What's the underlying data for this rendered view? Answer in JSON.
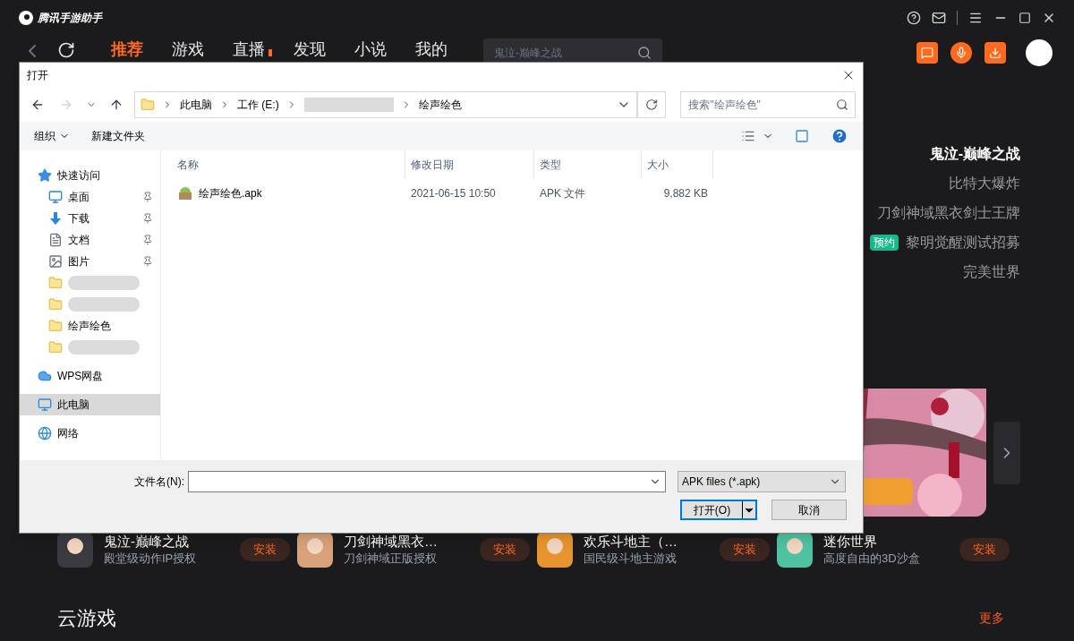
{
  "app": {
    "title": "腾讯手游助手"
  },
  "nav": {
    "tabs": [
      {
        "label": "推荐",
        "selected": true,
        "dot": false
      },
      {
        "label": "游戏",
        "selected": false,
        "dot": false
      },
      {
        "label": "直播",
        "selected": false,
        "dot": true
      },
      {
        "label": "发现",
        "selected": false,
        "dot": false
      },
      {
        "label": "小说",
        "selected": false,
        "dot": false
      },
      {
        "label": "我的",
        "selected": false,
        "dot": false
      }
    ],
    "search": {
      "placeholder": "鬼泣-巅峰之战"
    }
  },
  "featured": [
    {
      "title": "鬼泣-巅峰之战",
      "selected": true
    },
    {
      "title": "比特大爆炸",
      "selected": false
    },
    {
      "title": "刀剑神域黑衣剑士王牌",
      "selected": false
    },
    {
      "title": "黎明觉醒测试招募",
      "selected": false,
      "badge": "预约"
    },
    {
      "title": "完美世界",
      "selected": false
    }
  ],
  "games": [
    {
      "name": "鬼泣-巅峰之战",
      "desc": "殿堂级动作IP授权",
      "action": "安装",
      "color": "#3a3a40"
    },
    {
      "name": "刀剑神域黑衣…",
      "desc": "刀剑神域正版授权",
      "action": "安装",
      "color": "#d9a27a"
    },
    {
      "name": "欢乐斗地主（…",
      "desc": "国民级斗地主游戏",
      "action": "安装",
      "color": "#e8952f"
    },
    {
      "name": "迷你世界",
      "desc": "高度自由的3D沙盒",
      "action": "安装",
      "color": "#4fc3a1"
    }
  ],
  "section": {
    "title": "云游戏",
    "more": "更多"
  },
  "dialog": {
    "title": "打开",
    "path": [
      {
        "label": "此电脑",
        "redacted": false
      },
      {
        "label": "工作 (E:)",
        "redacted": false
      },
      {
        "redacted": true
      },
      {
        "label": "绘声绘色",
        "redacted": false
      }
    ],
    "search_placeholder": "搜索\"绘声绘色\"",
    "toolbar": {
      "organize": "组织",
      "new_folder": "新建文件夹"
    },
    "nav_pane": [
      {
        "kind": "star",
        "label": "快速访问",
        "selected": false,
        "children": [
          {
            "kind": "desktop",
            "label": "桌面",
            "pinned": true,
            "selected": false
          },
          {
            "kind": "download",
            "label": "下载",
            "pinned": true,
            "selected": false
          },
          {
            "kind": "document",
            "label": "文档",
            "pinned": true,
            "selected": false
          },
          {
            "kind": "pictures",
            "label": "图片",
            "pinned": true,
            "selected": false
          },
          {
            "kind": "folder",
            "pinned": false,
            "selected": false
          },
          {
            "kind": "folder",
            "pinned": false,
            "selected": false
          },
          {
            "kind": "folder",
            "label": "绘声绘色",
            "pinned": false,
            "selected": false
          },
          {
            "kind": "folder",
            "pinned": false,
            "selected": false
          }
        ]
      },
      {
        "kind": "cloud",
        "label": "WPS网盘",
        "selected": false
      },
      {
        "kind": "computer",
        "label": "此电脑",
        "selected": true
      },
      {
        "kind": "network",
        "label": "网络",
        "selected": false
      }
    ],
    "columns": [
      "名称",
      "修改日期",
      "类型",
      "大小"
    ],
    "files": [
      {
        "name": "绘声绘色.apk",
        "modified": "2021-06-15 10:50",
        "type": "APK 文件",
        "size": "9,882 KB"
      }
    ],
    "filename_label": "文件名(N):",
    "filter": "APK files (*.apk)",
    "open_button": "打开(O)",
    "cancel_button": "取消"
  }
}
